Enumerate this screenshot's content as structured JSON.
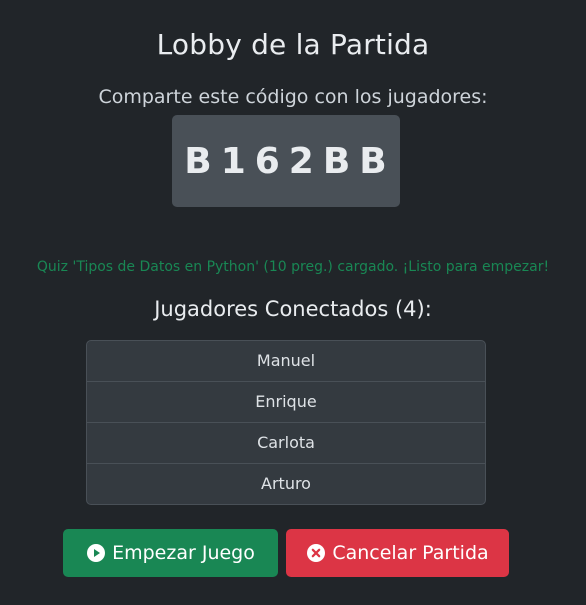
{
  "lobby": {
    "title": "Lobby de la Partida",
    "share_text": "Comparte este código con los jugadores:",
    "code": "B162BB",
    "status_message": "Quiz 'Tipos de Datos en Python' (10 preg.) cargado. ¡Listo para empezar!",
    "players_heading": "Jugadores Conectados (4):",
    "players": [
      "Manuel",
      "Enrique",
      "Carlota",
      "Arturo"
    ]
  },
  "actions": {
    "start_label": "Empezar Juego",
    "start_icon": "play-circle-icon",
    "cancel_label": "Cancelar Partida",
    "cancel_icon": "x-circle-icon"
  },
  "colors": {
    "background": "#212529",
    "code_box": "#495057",
    "success": "#198754",
    "danger": "#dc3545"
  }
}
